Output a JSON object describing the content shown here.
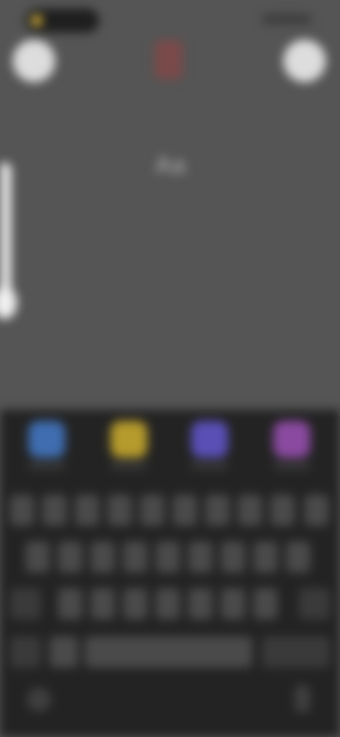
{
  "screen": {
    "background": "#555555",
    "center_text": "Aa"
  },
  "top_bar": {
    "left_button": "close-icon",
    "right_button": "done-icon",
    "center_icon": "text-style-icon"
  },
  "keyboard": {
    "suggestion_colors": [
      "#3f6db0",
      "#b59a2c",
      "#5a4fb5",
      "#8a4aa0"
    ],
    "colors": {
      "keyboard_bg": "#232323",
      "key_bg": "#4a4a4a",
      "func_key_bg": "#3a3a3a"
    }
  }
}
